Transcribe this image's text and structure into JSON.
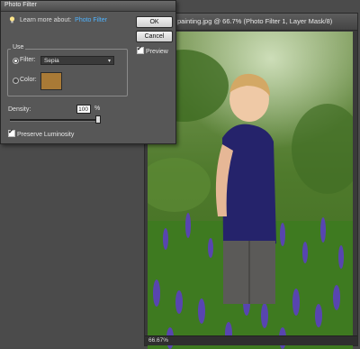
{
  "dialog": {
    "title": "Photo Filter",
    "learn_prefix": "Learn more about:",
    "learn_link": "Photo Filter",
    "ok_label": "OK",
    "cancel_label": "Cancel",
    "preview_label": "Preview",
    "preview_checked": true,
    "use_legend": "Use",
    "filter_label": "Filter:",
    "filter_value": "Sepia",
    "filter_selected": true,
    "color_label": "Color:",
    "swatch_color": "#a97a36",
    "density_label": "Density:",
    "density_value": "100",
    "density_unit": "%",
    "density_fraction": 1.0,
    "preserve_label": "Preserve Luminosity",
    "preserve_checked": true
  },
  "document": {
    "title": "painting.jpg @ 66.7% (Photo Filter 1, Layer Mask/8)",
    "zoom": "66.67%"
  }
}
